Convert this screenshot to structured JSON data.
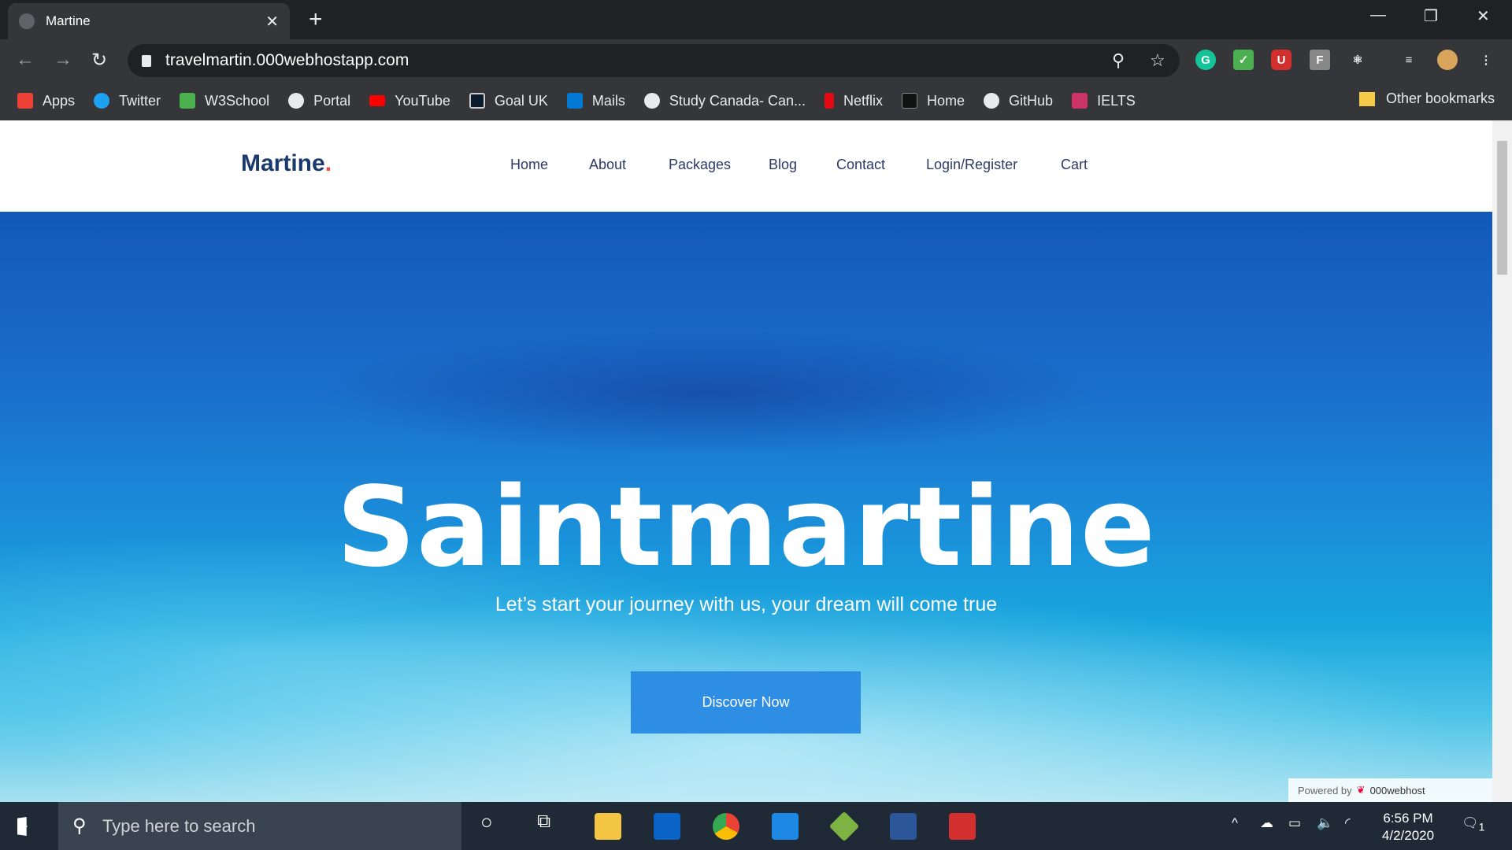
{
  "browser": {
    "tab_title": "Martine",
    "url": "travelmartin.000webhostapp.com",
    "bookmarks": [
      {
        "label": "Apps",
        "color": "#ea4335"
      },
      {
        "label": "Twitter",
        "color": "#1da1f2"
      },
      {
        "label": "W3School",
        "color": "#4caf50"
      },
      {
        "label": "Portal",
        "color": "#e8eaed"
      },
      {
        "label": "YouTube",
        "color": "#ff0000"
      },
      {
        "label": "Goal UK",
        "color": "#0b1b2b"
      },
      {
        "label": "Mails",
        "color": "#0078d4"
      },
      {
        "label": "Study Canada- Can...",
        "color": "#e8eaed"
      },
      {
        "label": "Netflix",
        "color": "#e50914"
      },
      {
        "label": "Home",
        "color": "#111"
      },
      {
        "label": "GitHub",
        "color": "#e8eaed"
      },
      {
        "label": "IELTS",
        "color": "#c36"
      }
    ],
    "other_bookmarks": "Other bookmarks"
  },
  "site": {
    "logo": "Martine",
    "logo_dot": ".",
    "nav": [
      "Home",
      "About",
      "Packages",
      "Blog",
      "Contact",
      "Login/Register",
      "Cart"
    ],
    "hero_title": "Saintmartine",
    "hero_subtitle": "Let’s start your journey with us, your dream will come true",
    "cta": "Discover Now",
    "powered_by": "Powered by",
    "host": "000webhost"
  },
  "taskbar": {
    "search_placeholder": "Type here to search",
    "time": "6:56 PM",
    "date": "4/2/2020",
    "notifications": "1"
  }
}
